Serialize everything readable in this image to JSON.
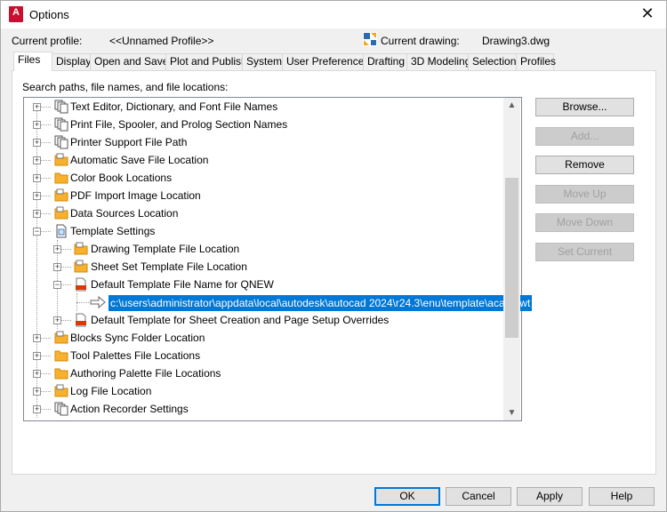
{
  "window": {
    "title": "Options",
    "app_icon_letter": "A",
    "app_icon_sub": "2024"
  },
  "header": {
    "current_profile_label": "Current profile:",
    "current_profile_value": "<<Unnamed Profile>>",
    "current_drawing_label": "Current drawing:",
    "current_drawing_value": "Drawing3.dwg"
  },
  "tabs": [
    {
      "label": "Files",
      "active": true
    },
    {
      "label": "Display"
    },
    {
      "label": "Open and Save"
    },
    {
      "label": "Plot and Publish"
    },
    {
      "label": "System"
    },
    {
      "label": "User Preferences"
    },
    {
      "label": "Drafting"
    },
    {
      "label": "3D Modeling"
    },
    {
      "label": "Selection"
    },
    {
      "label": "Profiles"
    }
  ],
  "files_panel": {
    "search_label": "Search paths, file names, and file locations:",
    "tree": [
      {
        "label": "Text Editor, Dictionary, and Font File Names",
        "icon": "pages-icon"
      },
      {
        "label": "Print File, Spooler, and Prolog Section Names",
        "icon": "pages-icon"
      },
      {
        "label": "Printer Support File Path",
        "icon": "pages-icon"
      },
      {
        "label": "Automatic Save File Location",
        "icon": "folder-icon"
      },
      {
        "label": "Color Book Locations",
        "icon": "folder-icon"
      },
      {
        "label": "PDF Import Image Location",
        "icon": "folder-icon"
      },
      {
        "label": "Data Sources Location",
        "icon": "folder-icon"
      },
      {
        "label": "Template Settings",
        "icon": "document-icon"
      },
      {
        "label": "Drawing Template File Location",
        "icon": "folder-icon"
      },
      {
        "label": "Sheet Set Template File Location",
        "icon": "folder-icon"
      },
      {
        "label": "Default Template File Name for QNEW",
        "icon": "dwt-icon"
      },
      {
        "label": "c:\\users\\administrator\\appdata\\local\\autodesk\\autocad 2024\\r24.3\\enu\\template\\acad.dwt",
        "icon": "arrow-icon"
      },
      {
        "label": "Default Template for Sheet Creation and Page Setup Overrides",
        "icon": "dwt-icon"
      },
      {
        "label": "Blocks Sync Folder Location",
        "icon": "folder-icon"
      },
      {
        "label": "Tool Palettes File Locations",
        "icon": "folder-icon"
      },
      {
        "label": "Authoring Palette File Locations",
        "icon": "folder-icon"
      },
      {
        "label": "Log File Location",
        "icon": "folder-icon"
      },
      {
        "label": "Action Recorder Settings",
        "icon": "pages-icon"
      }
    ],
    "selected_item": "c:\\users\\administrator\\appdata\\local\\autodesk\\autocad 2024\\r24.3\\enu\\template\\acad.dwt"
  },
  "side_buttons": {
    "browse": "Browse...",
    "add": "Add...",
    "remove": "Remove",
    "move_up": "Move Up",
    "move_down": "Move Down",
    "set_current": "Set Current"
  },
  "bottom_buttons": {
    "ok": "OK",
    "cancel": "Cancel",
    "apply": "Apply",
    "help": "Help"
  },
  "colors": {
    "selection": "#0078d7",
    "folder": "#f8b12c",
    "app_icon": "#c8102e",
    "dwt": "#d83b01"
  }
}
